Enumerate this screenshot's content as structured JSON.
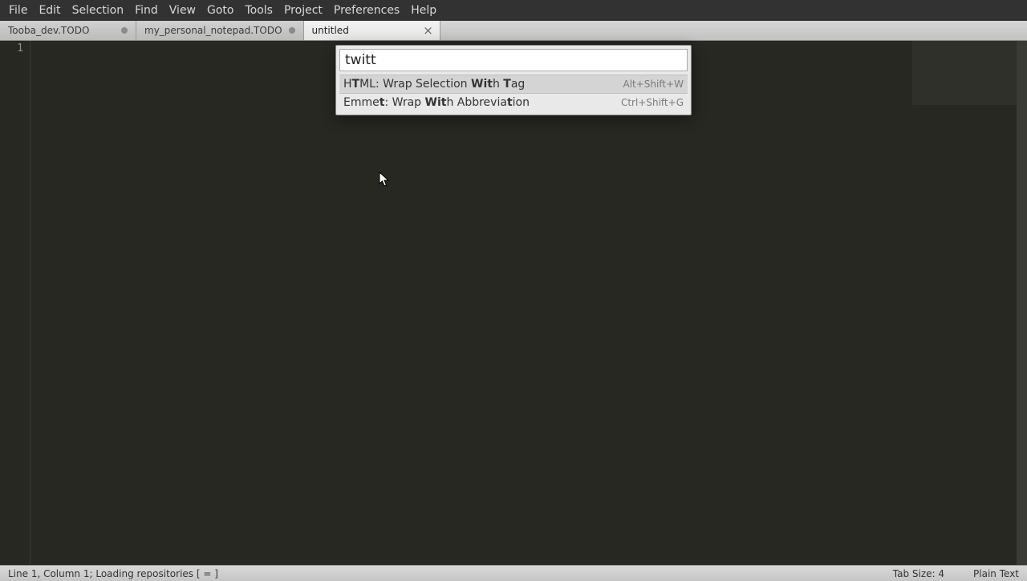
{
  "menubar": [
    "File",
    "Edit",
    "Selection",
    "Find",
    "View",
    "Goto",
    "Tools",
    "Project",
    "Preferences",
    "Help"
  ],
  "tabs": [
    {
      "title": "Tooba_dev.TODO",
      "dirty": true,
      "active": false
    },
    {
      "title": "my_personal_notepad.TODO",
      "dirty": true,
      "active": false
    },
    {
      "title": "untitled",
      "dirty": false,
      "active": true
    }
  ],
  "gutter": {
    "line1": "1"
  },
  "palette": {
    "input_value": "twitt",
    "rows": [
      {
        "label_html": "H<b>T</b>ML: Wrap Selection <b>Wit</b>h <b>T</b>ag",
        "shortcut": "Alt+Shift+W",
        "selected": true
      },
      {
        "label_html": "Emme<b>t</b>: Wrap <b>Wit</b>h Abbrevia<b>t</b>ion",
        "shortcut": "Ctrl+Shift+G",
        "selected": false
      }
    ]
  },
  "statusbar": {
    "left": "Line 1, Column 1; Loading repositories [     =  ]",
    "tab_size": "Tab Size: 4",
    "syntax": "Plain Text"
  }
}
